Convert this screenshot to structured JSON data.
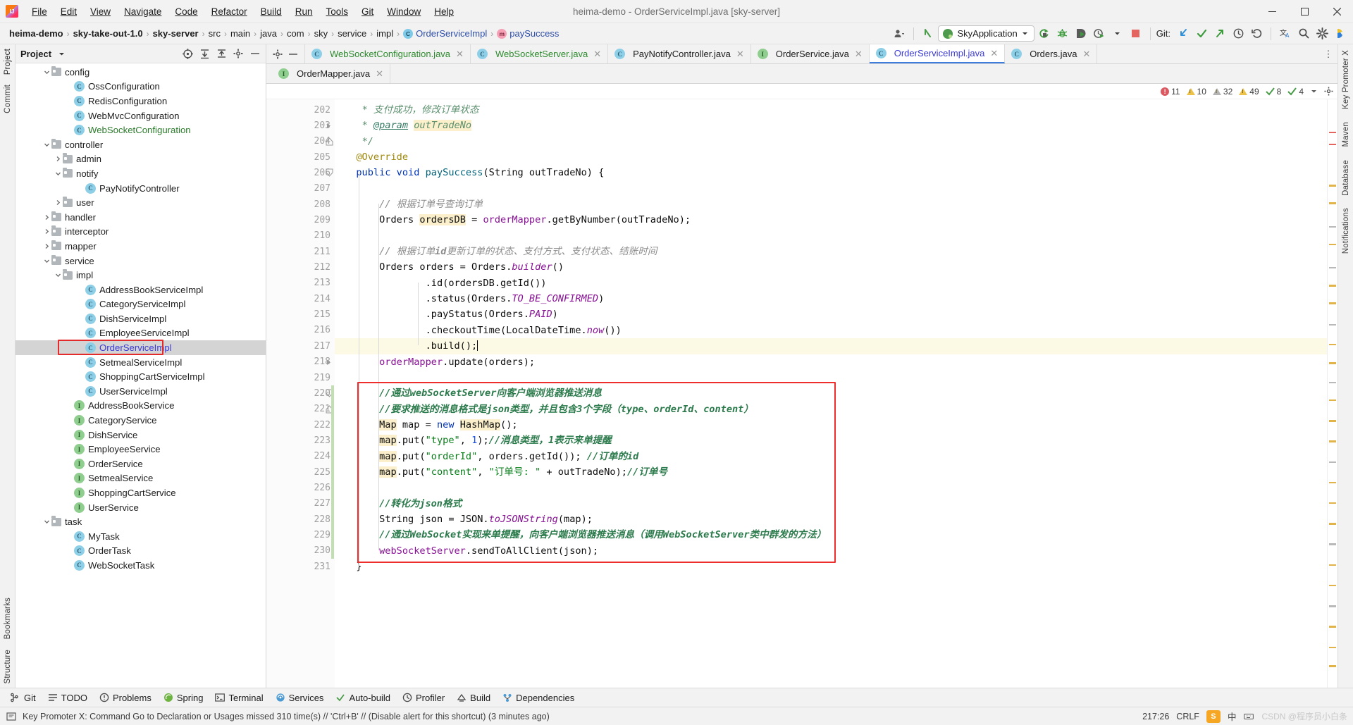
{
  "window": {
    "title": "heima-demo - OrderServiceImpl.java [sky-server]",
    "minimize": "–",
    "maximize": "❐",
    "close": "✕"
  },
  "menubar": {
    "items": [
      "File",
      "Edit",
      "View",
      "Navigate",
      "Code",
      "Refactor",
      "Build",
      "Run",
      "Tools",
      "Git",
      "Window",
      "Help"
    ]
  },
  "breadcrumbs": {
    "items": [
      {
        "label": "heima-demo",
        "style": "bold"
      },
      {
        "label": "sky-take-out-1.0",
        "style": "bold"
      },
      {
        "label": "sky-server",
        "style": "bold"
      },
      {
        "label": "src",
        "style": "plain"
      },
      {
        "label": "main",
        "style": "plain"
      },
      {
        "label": "java",
        "style": "plain"
      },
      {
        "label": "com",
        "style": "plain"
      },
      {
        "label": "sky",
        "style": "plain"
      },
      {
        "label": "service",
        "style": "plain"
      },
      {
        "label": "impl",
        "style": "plain"
      },
      {
        "label": "OrderServiceImpl",
        "style": "link",
        "badge": "C"
      },
      {
        "label": "paySuccess",
        "style": "link",
        "badge": "m"
      }
    ],
    "separator": "›"
  },
  "toolbar": {
    "run_config": "SkyApplication",
    "git_label": "Git:",
    "icons": [
      "user-settings-icon",
      "back-arrow-icon",
      "run-icon",
      "debug-icon",
      "run-with-coverage-icon",
      "profiler-icon",
      "stop-icon",
      "git-update-icon",
      "git-commit-icon",
      "git-push-icon",
      "history-icon",
      "rollback-icon",
      "translate-icon",
      "search-icon",
      "settings-icon",
      "ide-assistant-icon"
    ]
  },
  "left_rail": {
    "top": [
      "Project",
      "Commit"
    ],
    "bottom": [
      "Bookmarks",
      "Structure"
    ]
  },
  "right_rail": {
    "items": [
      "Key Promoter X",
      "Maven",
      "Database",
      "Notifications"
    ]
  },
  "project_panel": {
    "title": "Project",
    "header_icons": [
      "locate-icon",
      "expand-all-icon",
      "collapse-all-icon",
      "settings-icon",
      "hide-icon"
    ],
    "tree": [
      {
        "indent": 2,
        "twist": "v",
        "icon": "folder",
        "label": "config",
        "color": "plain"
      },
      {
        "indent": 4,
        "twist": "",
        "icon": "class",
        "label": "OssConfiguration",
        "color": "plain"
      },
      {
        "indent": 4,
        "twist": "",
        "icon": "class",
        "label": "RedisConfiguration",
        "color": "plain"
      },
      {
        "indent": 4,
        "twist": "",
        "icon": "class",
        "label": "WebMvcConfiguration",
        "color": "plain"
      },
      {
        "indent": 4,
        "twist": "",
        "icon": "class",
        "label": "WebSocketConfiguration",
        "color": "green"
      },
      {
        "indent": 2,
        "twist": "v",
        "icon": "folder",
        "label": "controller",
        "color": "plain"
      },
      {
        "indent": 3,
        "twist": ">",
        "icon": "folder",
        "label": "admin",
        "color": "plain"
      },
      {
        "indent": 3,
        "twist": "v",
        "icon": "folder",
        "label": "notify",
        "color": "plain"
      },
      {
        "indent": 5,
        "twist": "",
        "icon": "class",
        "label": "PayNotifyController",
        "color": "plain"
      },
      {
        "indent": 3,
        "twist": ">",
        "icon": "folder",
        "label": "user",
        "color": "plain"
      },
      {
        "indent": 2,
        "twist": ">",
        "icon": "folder",
        "label": "handler",
        "color": "plain"
      },
      {
        "indent": 2,
        "twist": ">",
        "icon": "folder",
        "label": "interceptor",
        "color": "plain"
      },
      {
        "indent": 2,
        "twist": ">",
        "icon": "folder",
        "label": "mapper",
        "color": "plain"
      },
      {
        "indent": 2,
        "twist": "v",
        "icon": "folder",
        "label": "service",
        "color": "plain"
      },
      {
        "indent": 3,
        "twist": "v",
        "icon": "folder",
        "label": "impl",
        "color": "plain"
      },
      {
        "indent": 5,
        "twist": "",
        "icon": "class",
        "label": "AddressBookServiceImpl",
        "color": "plain"
      },
      {
        "indent": 5,
        "twist": "",
        "icon": "class",
        "label": "CategoryServiceImpl",
        "color": "plain"
      },
      {
        "indent": 5,
        "twist": "",
        "icon": "class",
        "label": "DishServiceImpl",
        "color": "plain"
      },
      {
        "indent": 5,
        "twist": "",
        "icon": "class",
        "label": "EmployeeServiceImpl",
        "color": "plain"
      },
      {
        "indent": 5,
        "twist": "",
        "icon": "class",
        "label": "OrderServiceImpl",
        "color": "blue",
        "selected": true
      },
      {
        "indent": 5,
        "twist": "",
        "icon": "class",
        "label": "SetmealServiceImpl",
        "color": "plain"
      },
      {
        "indent": 5,
        "twist": "",
        "icon": "class",
        "label": "ShoppingCartServiceImpl",
        "color": "plain"
      },
      {
        "indent": 5,
        "twist": "",
        "icon": "class",
        "label": "UserServiceImpl",
        "color": "plain"
      },
      {
        "indent": 4,
        "twist": "",
        "icon": "iface",
        "label": "AddressBookService",
        "color": "plain"
      },
      {
        "indent": 4,
        "twist": "",
        "icon": "iface",
        "label": "CategoryService",
        "color": "plain"
      },
      {
        "indent": 4,
        "twist": "",
        "icon": "iface",
        "label": "DishService",
        "color": "plain"
      },
      {
        "indent": 4,
        "twist": "",
        "icon": "iface",
        "label": "EmployeeService",
        "color": "plain"
      },
      {
        "indent": 4,
        "twist": "",
        "icon": "iface",
        "label": "OrderService",
        "color": "plain"
      },
      {
        "indent": 4,
        "twist": "",
        "icon": "iface",
        "label": "SetmealService",
        "color": "plain"
      },
      {
        "indent": 4,
        "twist": "",
        "icon": "iface",
        "label": "ShoppingCartService",
        "color": "plain"
      },
      {
        "indent": 4,
        "twist": "",
        "icon": "iface",
        "label": "UserService",
        "color": "plain"
      },
      {
        "indent": 2,
        "twist": "v",
        "icon": "folder",
        "label": "task",
        "color": "plain"
      },
      {
        "indent": 4,
        "twist": "",
        "icon": "class",
        "label": "MyTask",
        "color": "plain"
      },
      {
        "indent": 4,
        "twist": "",
        "icon": "class",
        "label": "OrderTask",
        "color": "plain"
      },
      {
        "indent": 4,
        "twist": "",
        "icon": "class",
        "label": "WebSocketTask",
        "color": "plain"
      }
    ]
  },
  "editor_tabs": {
    "row1": [
      {
        "label": "WebSocketConfiguration.java",
        "icon": "class",
        "color": "green",
        "active": false
      },
      {
        "label": "WebSocketServer.java",
        "icon": "class",
        "color": "green",
        "active": false
      },
      {
        "label": "PayNotifyController.java",
        "icon": "class",
        "color": "plain",
        "active": false
      },
      {
        "label": "OrderService.java",
        "icon": "iface",
        "color": "plain",
        "active": false
      },
      {
        "label": "OrderServiceImpl.java",
        "icon": "class",
        "color": "blue",
        "active": true
      },
      {
        "label": "Orders.java",
        "icon": "class",
        "color": "plain",
        "active": false
      }
    ],
    "row2": [
      {
        "label": "OrderMapper.java",
        "icon": "iface",
        "color": "plain",
        "active": false
      }
    ],
    "close_glyph": "✕",
    "more_glyph": "⋮"
  },
  "inspection_summary": {
    "errors": "11",
    "warnings": "10",
    "weak_warnings": "32",
    "typos": "49",
    "grammar": "8",
    "other": "4"
  },
  "code": {
    "first_line_number": 202,
    "lines": [
      {
        "n": 202,
        "html": "   <span class=\"doc\">* 支付成功，修改订单状态</span>"
      },
      {
        "n": 203,
        "html": "   <span class=\"doc\">* </span><span class=\"doctag\">@param</span><span class=\"doc\"> </span><span class=\"hlw\"><span class=\"doc\">outTradeNo</span></span>"
      },
      {
        "n": 204,
        "html": "   <span class=\"doc\">*/</span>"
      },
      {
        "n": 205,
        "html": "  <span class=\"anno\">@Override</span>"
      },
      {
        "n": 206,
        "html": "  <span class=\"kw\">public</span> <span class=\"kw\">void</span> <span class=\"mth\">paySuccess</span>(<span class=\"typ\">String</span> outTradeNo) {"
      },
      {
        "n": 207,
        "html": ""
      },
      {
        "n": 208,
        "html": "      <span class=\"cmt\">// 根据订单号查询订单</span>"
      },
      {
        "n": 209,
        "html": "      Orders <span class=\"hlw\">ordersDB</span> = <span class=\"fld\">orderMapper</span>.getByNumber(outTradeNo);"
      },
      {
        "n": 210,
        "html": ""
      },
      {
        "n": 211,
        "html": "      <span class=\"cmt\">// 根据订单<b>id</b>更新订单的状态、支付方式、支付状态、结账时间</span>"
      },
      {
        "n": 212,
        "html": "      Orders orders = Orders.<span class=\"stat\">builder</span>()"
      },
      {
        "n": 213,
        "html": "              .id(ordersDB.getId())"
      },
      {
        "n": 214,
        "html": "              .status(Orders.<span class=\"stat\">TO_BE_CONFIRMED</span>)"
      },
      {
        "n": 215,
        "html": "              .payStatus(Orders.<span class=\"stat\">PAID</span>)"
      },
      {
        "n": 216,
        "html": "              .checkoutTime(LocalDateTime.<span class=\"stat\">now</span>())"
      },
      {
        "n": 217,
        "html": "              .build();<span class=\"caret\"></span>",
        "highlight": true
      },
      {
        "n": 218,
        "html": "      <span class=\"fld\">orderMapper</span>.update(orders);"
      },
      {
        "n": 219,
        "html": ""
      },
      {
        "n": 220,
        "html": "      <span class=\"cgreenB\">//通过webSocketServer向客户端浏览器推送消息</span>"
      },
      {
        "n": 221,
        "html": "      <span class=\"cgreenB\">//要求推送的消息格式是json类型，并且包含3个字段（type、orderId、content）</span>"
      },
      {
        "n": 222,
        "html": "      <span class=\"hlw\">Map</span> map = <span class=\"kw\">new</span> <span class=\"hlw\">HashMap</span>();"
      },
      {
        "n": 223,
        "html": "      <span class=\"hlw\">map</span>.put(<span class=\"str\">\"type\"</span>, <span class=\"num\">1</span>);<span class=\"cgreenB\">//消息类型，1表示来单提醒</span>"
      },
      {
        "n": 224,
        "html": "      <span class=\"hlw\">map</span>.put(<span class=\"str\">\"orderId\"</span>, orders.getId()); <span class=\"cgreenB\">//订单的id</span>"
      },
      {
        "n": 225,
        "html": "      <span class=\"hlw\">map</span>.put(<span class=\"str\">\"content\"</span>, <span class=\"str\">\"订单号: \"</span> + outTradeNo);<span class=\"cgreenB\">//订单号</span>"
      },
      {
        "n": 226,
        "html": ""
      },
      {
        "n": 227,
        "html": "      <span class=\"cgreenB\">//转化为json格式</span>"
      },
      {
        "n": 228,
        "html": "      <span class=\"typ\">String</span> json = JSON.<span class=\"stat\">toJSONString</span>(map);"
      },
      {
        "n": 229,
        "html": "      <span class=\"cgreenB\">//通过WebSocket实现来单提醒，向客户端浏览器推送消息（调用WebSocketServer类中群发的方法）</span>"
      },
      {
        "n": 230,
        "html": "      <span class=\"fld\">webSocketServer</span>.sendToAllClient(json);"
      },
      {
        "n": 231,
        "html": "  }"
      }
    ]
  },
  "tool_windows": {
    "items": [
      {
        "label": "Git",
        "icon": "git-icon"
      },
      {
        "label": "TODO",
        "icon": "todo-icon"
      },
      {
        "label": "Problems",
        "icon": "problems-icon"
      },
      {
        "label": "Spring",
        "icon": "spring-icon"
      },
      {
        "label": "Terminal",
        "icon": "terminal-icon"
      },
      {
        "label": "Services",
        "icon": "services-icon"
      },
      {
        "label": "Auto-build",
        "icon": "auto-build-icon"
      },
      {
        "label": "Profiler",
        "icon": "profiler-icon"
      },
      {
        "label": "Build",
        "icon": "build-icon"
      },
      {
        "label": "Dependencies",
        "icon": "dependencies-icon"
      }
    ]
  },
  "statusbar": {
    "message": "Key Promoter X: Command Go to Declaration or Usages missed 310 time(s) // 'Ctrl+B' // (Disable alert for this shortcut) (3 minutes ago)",
    "caret_position": "217:26",
    "line_separator": "CRLF",
    "ime_lang": "中",
    "watermark": "CSDN @程序员小白条"
  },
  "colors": {
    "accent": "#3e7ddb",
    "highlight_box": "#ee2d2d",
    "selection": "#d4d4d4",
    "line_highlight": "#fcfae4",
    "token_highlight": "#fbf0cb",
    "string_green": "#067d17",
    "keyword_blue": "#0033b3",
    "comment_grey": "#8c8c8c"
  }
}
